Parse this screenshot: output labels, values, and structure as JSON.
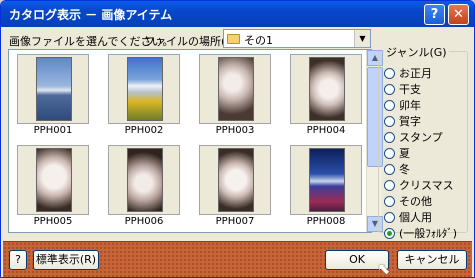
{
  "window": {
    "title": "カタログ表示 － 画像アイテム",
    "help": "?",
    "close": "✕"
  },
  "toolbar": {
    "choose_label": "画像ファイルを選んでください。",
    "location_label": "ファイルの場所(I):",
    "location_value": "その1"
  },
  "items": [
    {
      "label": "PPH001"
    },
    {
      "label": "PPH002"
    },
    {
      "label": "PPH003"
    },
    {
      "label": "PPH004"
    },
    {
      "label": "PPH005"
    },
    {
      "label": "PPH006"
    },
    {
      "label": "PPH007"
    },
    {
      "label": "PPH008"
    }
  ],
  "genre": {
    "title": "ジャンル(G)",
    "options": [
      "お正月",
      "干支",
      "卯年",
      "賀字",
      "スタンプ",
      "夏",
      "冬",
      "クリスマス",
      "その他",
      "個人用",
      "(一般ﾌｫﾙﾀﾞ)"
    ],
    "selected": "(一般ﾌｫﾙﾀﾞ)"
  },
  "footer": {
    "help_icon": "?",
    "standard_view": "標準表示(R)",
    "ok": "OK",
    "cancel": "キャンセル"
  },
  "colors": {
    "titlebar": "#0a5ae8",
    "footer": "#c8643a"
  }
}
